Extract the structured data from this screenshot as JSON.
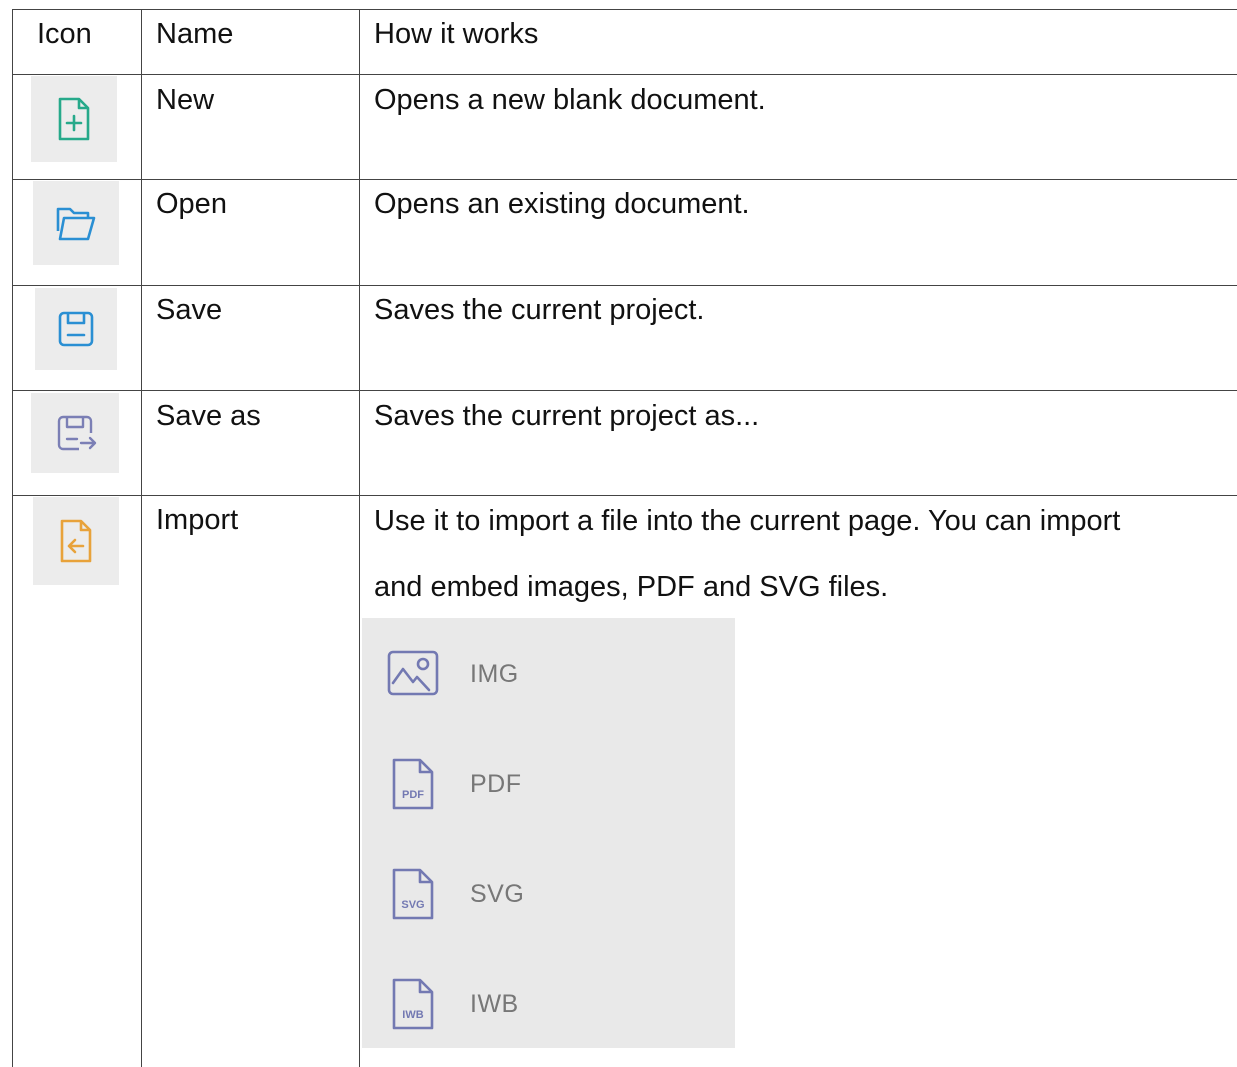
{
  "table": {
    "headers": {
      "icon": "Icon",
      "name": "Name",
      "how": "How it works"
    },
    "rows": [
      {
        "icon": "new-file-icon",
        "color": "#26a98a",
        "name": "New",
        "desc": "Opens a new blank document."
      },
      {
        "icon": "open-folder-icon",
        "color": "#2a8fd3",
        "name": "Open",
        "desc": "Opens an existing document."
      },
      {
        "icon": "save-icon",
        "color": "#2a8fd3",
        "name": "Save",
        "desc": "Saves the current project."
      },
      {
        "icon": "save-as-icon",
        "color": "#7b7fb5",
        "name": "Save as",
        "desc": "Saves the current project as..."
      },
      {
        "icon": "import-icon",
        "color": "#e8a23a",
        "name": "Import",
        "desc": "Use it to import a file into the current page. You can import and embed images, PDF and SVG files."
      }
    ]
  },
  "import_menu": {
    "items": [
      {
        "icon": "image-file-icon",
        "label": "IMG",
        "badge": ""
      },
      {
        "icon": "pdf-file-icon",
        "label": "PDF",
        "badge": "PDF"
      },
      {
        "icon": "svg-file-icon",
        "label": "SVG",
        "badge": "SVG"
      },
      {
        "icon": "iwb-file-icon",
        "label": "IWB",
        "badge": "IWB"
      }
    ],
    "icon_color": "#7379b2"
  }
}
